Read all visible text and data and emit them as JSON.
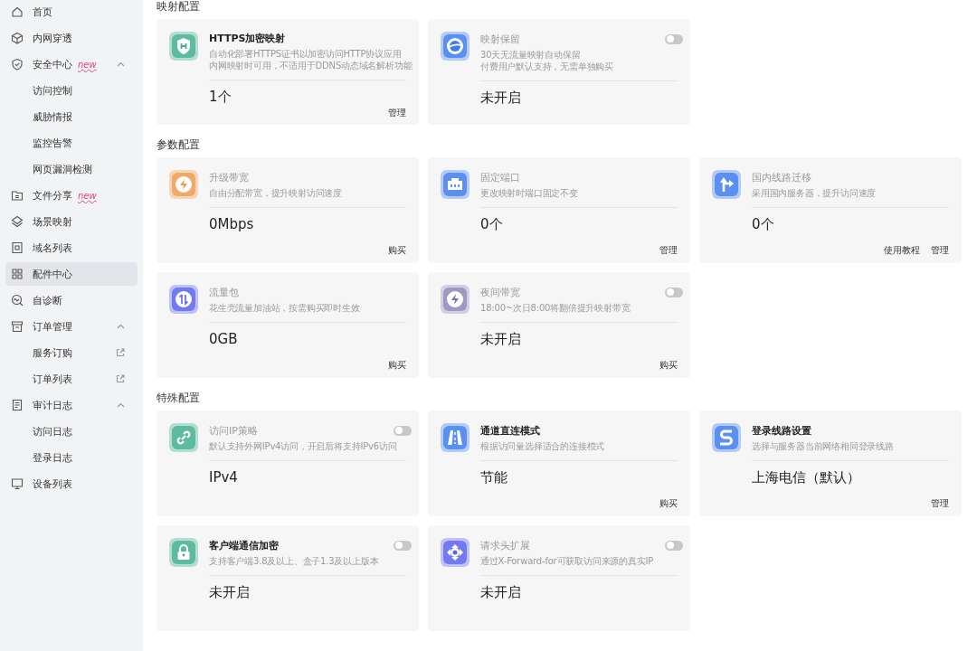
{
  "sidebar": {
    "items": [
      {
        "label": "首页",
        "selected": false
      },
      {
        "label": "内网穿透",
        "selected": false
      },
      {
        "label": "安全中心",
        "badge": "new",
        "expanded": true,
        "selected": false,
        "children": [
          {
            "label": "访问控制",
            "selected": false
          },
          {
            "label": "威胁情报",
            "selected": false
          },
          {
            "label": "监控告警",
            "selected": false
          },
          {
            "label": "网页漏洞检测",
            "selected": false
          }
        ]
      },
      {
        "label": "文件分享",
        "badge": "new",
        "selected": false
      },
      {
        "label": "场景映射",
        "selected": false
      },
      {
        "label": "域名列表",
        "selected": false
      },
      {
        "label": "配件中心",
        "selected": true
      },
      {
        "label": "自诊断",
        "selected": false
      },
      {
        "label": "订单管理",
        "expanded": true,
        "selected": false,
        "children": [
          {
            "label": "服务订购",
            "external_link": true,
            "selected": false
          },
          {
            "label": "订单列表",
            "external_link": true,
            "selected": false
          }
        ]
      },
      {
        "label": "审计日志",
        "expanded": true,
        "selected": false,
        "children": [
          {
            "label": "访问日志",
            "selected": false
          },
          {
            "label": "登录日志",
            "selected": false
          }
        ]
      },
      {
        "label": "设备列表",
        "selected": false
      }
    ]
  },
  "sections": [
    {
      "title": "映射配置",
      "cards": [
        {
          "title": "HTTPS加密映射",
          "enabled": true,
          "description": [
            "自动化部署HTTPS证书以加密访问HTTP协议应用",
            "内网映射时可用，不适用于DDNS动态域名解析功能"
          ],
          "value": "1个",
          "actions": [
            "管理"
          ]
        },
        {
          "title": "映射保留",
          "enabled": false,
          "switch_on": false,
          "description": [
            "30天无流量映射自动保留",
            "付费用户默认支持，无需单独购买"
          ],
          "value": "未开启"
        }
      ]
    },
    {
      "title": "参数配置",
      "cards": [
        {
          "title": "升级带宽",
          "enabled": false,
          "description": [
            "自由分配带宽，提升映射访问速度"
          ],
          "value": "0Mbps",
          "actions": [
            "购买"
          ]
        },
        {
          "title": "固定端口",
          "enabled": false,
          "description": [
            "更改映射时端口固定不变"
          ],
          "value": "0个",
          "actions": [
            "管理"
          ]
        },
        {
          "title": "国内线路迁移",
          "enabled": false,
          "description": [
            "采用国内服务器，提升访问速度"
          ],
          "value": "0个",
          "actions": [
            "使用教程",
            "管理"
          ]
        },
        {
          "title": "流量包",
          "enabled": false,
          "description": [
            "花生壳流量加油站，按需购买即时生效"
          ],
          "value": "0GB",
          "actions": [
            "购买"
          ]
        },
        {
          "title": "夜间带宽",
          "enabled": false,
          "switch_on": false,
          "description": [
            "18:00~次日8:00将翻倍提升映射带宽"
          ],
          "value": "未开启",
          "actions": [
            "购买"
          ]
        }
      ]
    },
    {
      "title": "特殊配置",
      "cards": [
        {
          "title": "访问IP策略",
          "enabled": false,
          "switch_on": false,
          "description": [
            "默认支持外网IPv4访问，开启后将支持IPv6访问"
          ],
          "value": "IPv4"
        },
        {
          "title": "通道直连模式",
          "enabled": true,
          "description": [
            "根据访问量选择适合的连接模式"
          ],
          "value": "节能",
          "actions": [
            "购买"
          ]
        },
        {
          "title": "登录线路设置",
          "enabled": true,
          "description": [
            "选择与服务器当前网络相同登录线路"
          ],
          "value": "上海电信（默认）",
          "actions": [
            "管理"
          ]
        },
        {
          "title": "客户端通信加密",
          "enabled": true,
          "switch_on": false,
          "description": [
            "支持客户端3.8及以上、盒子1.3及以上版本"
          ],
          "value": "未开启"
        },
        {
          "title": "请求头扩展",
          "enabled": false,
          "switch_on": false,
          "description": [
            "通过X-Forward-for可获取访问来源的真实IP"
          ],
          "value": "未开启"
        }
      ]
    }
  ]
}
